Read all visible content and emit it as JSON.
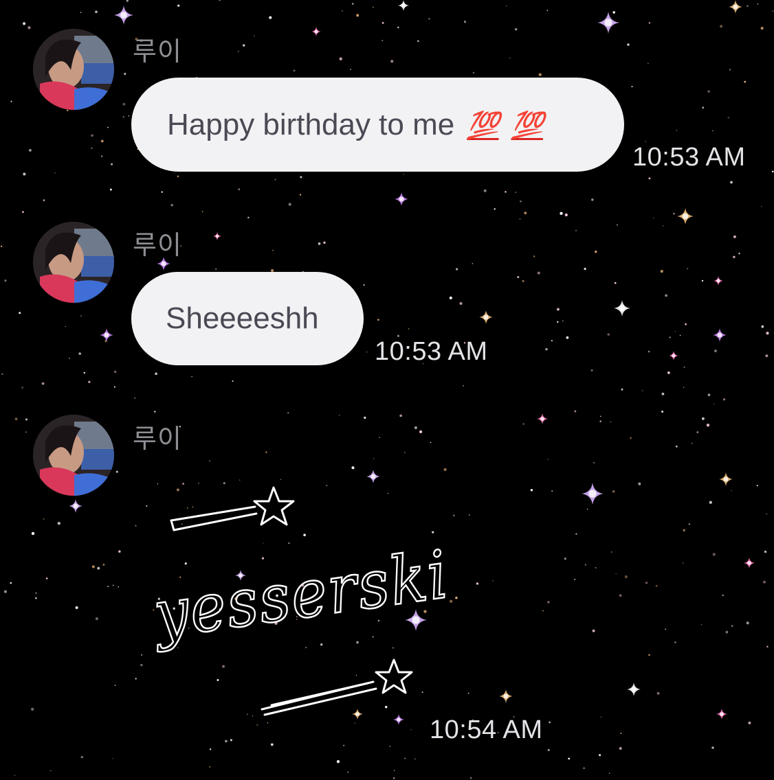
{
  "messages": [
    {
      "sender": "루이",
      "text": "Happy birthday to me",
      "emoji": [
        "💯",
        "💯"
      ],
      "emoji_name": "hundred-points-emoji",
      "time": "10:53 AM"
    },
    {
      "sender": "루이",
      "text": "Sheeeeshh",
      "time": "10:53 AM"
    },
    {
      "sender": "루이",
      "sticker_text": "yesserski",
      "sticker_icons": [
        "shooting-star-icon",
        "shooting-star-icon"
      ],
      "time": "10:54 AM"
    }
  ],
  "colors": {
    "background": "#000000",
    "bubble": "#f2f2f4",
    "bubble_text": "#4a4a55",
    "sender_text": "#8e8e93",
    "time_text": "#e4e4e8",
    "emoji_red": "#d8231f"
  }
}
